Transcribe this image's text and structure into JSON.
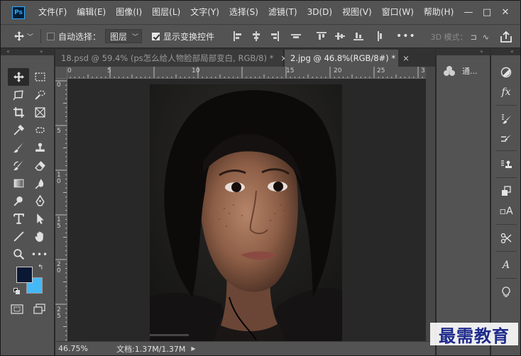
{
  "app": {
    "logo_text": "Ps"
  },
  "menu": [
    "文件(F)",
    "编辑(E)",
    "图像(I)",
    "图层(L)",
    "文字(Y)",
    "选择(S)",
    "滤镜(T)",
    "3D(D)",
    "视图(V)",
    "窗口(W)",
    "帮助(H)"
  ],
  "window_controls": {
    "minimize": "—",
    "maximize": "□",
    "close": "✕"
  },
  "options": {
    "auto_select_label": "自动选择：",
    "auto_select_checked": false,
    "auto_select_target": "图层",
    "show_transform_label": "显示变换控件",
    "show_transform_checked": true,
    "more_label": "•••",
    "mode_3d_label": "3D 模式："
  },
  "strip": {
    "collapse_left": "«",
    "collapse_right": "»",
    "collapse_dock": "«"
  },
  "tabs": [
    {
      "label": "18.psd @ 59.4% (ps怎么给人物脸部局部变白, RGB/8) *",
      "close": "×",
      "active": false
    },
    {
      "label": "2.jpg @ 46.8%(RGB/8#) *",
      "close": "×",
      "active": true
    }
  ],
  "ruler": {
    "top": [
      "0",
      "5",
      "10",
      "15",
      "20",
      "25",
      "3"
    ],
    "left": [
      "0",
      "5",
      "1\n0",
      "1\n5",
      "2\n0",
      "2\n5"
    ]
  },
  "status": {
    "zoom": "46.75%",
    "doc_info": "文档:1.37M/1.37M",
    "arrow": "▶"
  },
  "panel": {
    "channels_label": "通..."
  },
  "watermark": "最需教育",
  "colors": {
    "foreground": "#0b1833",
    "background": "#45b8f7"
  }
}
